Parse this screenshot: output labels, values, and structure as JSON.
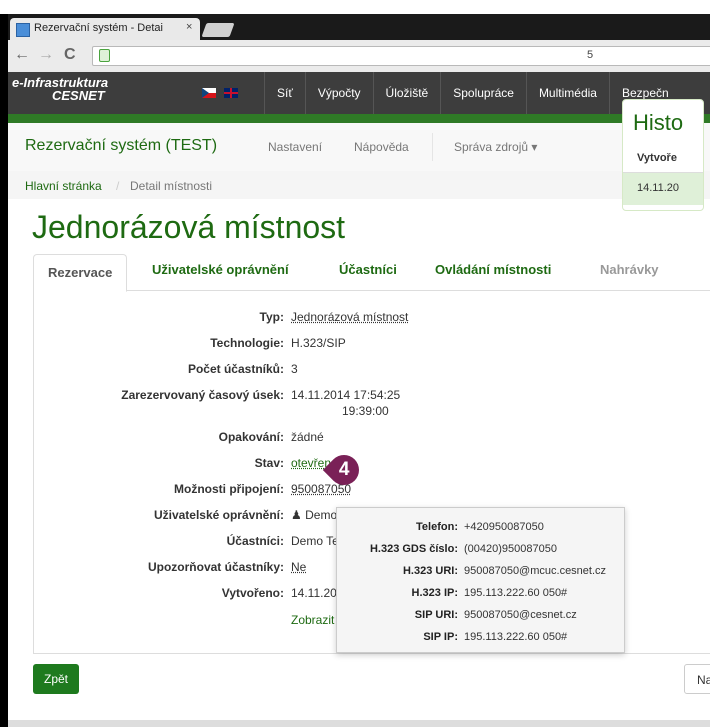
{
  "browser": {
    "tab_title": "Rezervační systém - Detai",
    "tab_close": "×",
    "url_fragment": "5",
    "nav": {
      "back": "←",
      "forward": "→",
      "reload": "C"
    }
  },
  "caption_fragment": "„",
  "cesnet_bar": {
    "logo_line1": "e-Infrastruktura",
    "logo_line2": "CESNET",
    "menu": [
      "Síť",
      "Výpočty",
      "Úložiště",
      "Spolupráce",
      "Multimédia",
      "Bezpečn"
    ]
  },
  "app_nav": {
    "brand": "Rezervační systém (TEST)",
    "links": [
      "Nastavení",
      "Nápověda",
      "Správa zdrojů ▾"
    ]
  },
  "breadcrumb": {
    "home": "Hlavní stránka",
    "separator": "/",
    "current": "Detail místnosti"
  },
  "page_title": "Jednorázová místnost",
  "tabs": [
    {
      "label": "Rezervace",
      "state": "active"
    },
    {
      "label": "Uživatelské oprávnění",
      "state": "link"
    },
    {
      "label": "Účastníci",
      "state": "link"
    },
    {
      "label": "Ovládání místnosti",
      "state": "link"
    },
    {
      "label": "Nahrávky",
      "state": "disabled"
    }
  ],
  "details": [
    {
      "label": "Typ:",
      "value": "Jednorázová místnost"
    },
    {
      "label": "Technologie:",
      "value": "H.323/SIP"
    },
    {
      "label": "Počet účastníků:",
      "value": "3"
    },
    {
      "label": "Zarezervovaný časový úsek:",
      "value": "14.11.2014 17:54:25",
      "value2": "19:39:00"
    },
    {
      "label": "Opakování:",
      "value": "žádné"
    },
    {
      "label": "Stav:",
      "value": "otevřena"
    },
    {
      "label": "Možnosti připojení:",
      "value": "950087050"
    },
    {
      "label": "Uživatelské oprávnění:",
      "value": "Demo Te"
    },
    {
      "label": "Účastníci:",
      "value": "Demo Teste"
    },
    {
      "label": "Upozorňovat účastníky:",
      "value": "Ne"
    },
    {
      "label": "Vytvořeno:",
      "value": "14.11.2014"
    }
  ],
  "show_more": "Zobrazit po",
  "badge": "4",
  "history": {
    "title": "Histo",
    "col": "Vytvoře",
    "row": "14.11.20"
  },
  "popup": [
    {
      "label": "Telefon:",
      "value": "+420950087050"
    },
    {
      "label": "H.323 GDS číslo:",
      "value": "(00420)950087050"
    },
    {
      "label": "H.323 URI:",
      "value": "950087050@mcuc.cesnet.cz"
    },
    {
      "label": "H.323 IP:",
      "value": "195.113.222.60 050#"
    },
    {
      "label": "SIP URI:",
      "value": "950087050@cesnet.cz"
    },
    {
      "label": "SIP IP:",
      "value": "195.113.222.60 050#"
    }
  ],
  "buttons": {
    "back": "Zpět",
    "next": "Na"
  }
}
